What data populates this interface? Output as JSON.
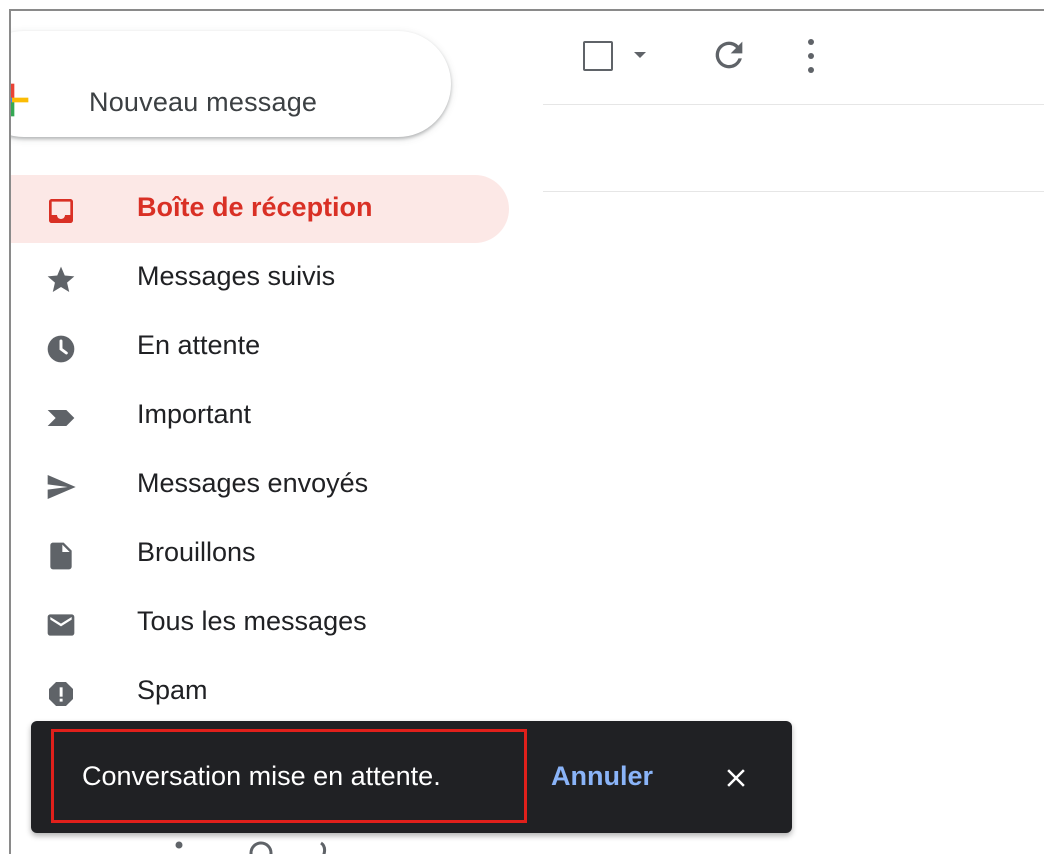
{
  "compose": {
    "label": "Nouveau message",
    "icon": "plus-multicolor-icon"
  },
  "toolbar": {
    "select_icon": "checkbox-icon",
    "select_menu_icon": "caret-down-icon",
    "refresh_icon": "refresh-icon",
    "more_icon": "more-vert-icon"
  },
  "nav": {
    "items": [
      {
        "label": "Boîte de réception",
        "icon": "inbox-icon",
        "active": true
      },
      {
        "label": "Messages suivis",
        "icon": "star-icon"
      },
      {
        "label": "En attente",
        "icon": "clock-icon"
      },
      {
        "label": "Important",
        "icon": "important-icon"
      },
      {
        "label": "Messages envoyés",
        "icon": "send-icon"
      },
      {
        "label": "Brouillons",
        "icon": "draft-icon"
      },
      {
        "label": "Tous les messages",
        "icon": "mail-icon"
      },
      {
        "label": "Spam",
        "icon": "report-icon"
      }
    ]
  },
  "snackbar": {
    "message": "Conversation mise en attente.",
    "undo_label": "Annuler",
    "close_icon": "close-icon"
  },
  "colors": {
    "active_text": "#d93025",
    "active_bg": "#fce8e6",
    "snackbar_bg": "#202124",
    "undo": "#8ab4f8",
    "highlight": "#e0201b"
  }
}
